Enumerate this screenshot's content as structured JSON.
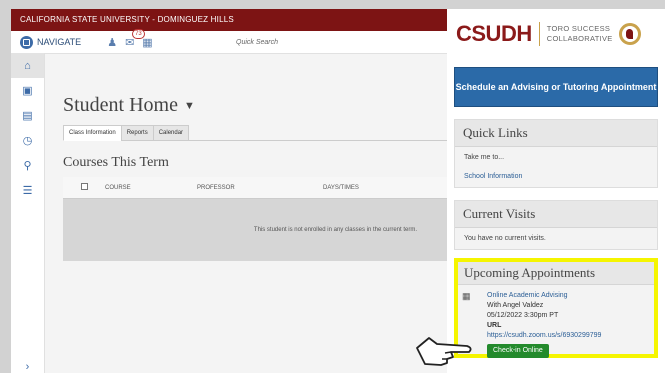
{
  "topbar": {
    "title": "CALIFORNIA STATE UNIVERSITY - DOMINGUEZ HILLS"
  },
  "nav": {
    "navigate": "NAVIGATE",
    "badge_count": "73",
    "quick_search": "Quick Search"
  },
  "main": {
    "title": "Student Home",
    "tabs": [
      {
        "label": "Class Information"
      },
      {
        "label": "Reports"
      },
      {
        "label": "Calendar"
      }
    ],
    "courses_heading": "Courses This Term",
    "table": {
      "headers": [
        "COURSE",
        "PROFESSOR",
        "DAYS/TIMES"
      ],
      "empty_message": "This student is not enrolled in any classes in the current term."
    }
  },
  "sidebar": {
    "logo": {
      "name": "CSUDH",
      "collab_line1": "TORO SUCCESS",
      "collab_line2": "COLLABORATIVE"
    },
    "schedule_button": "Schedule an Advising or Tutoring Appointment",
    "quick_links": {
      "title": "Quick Links",
      "text": "Take me to...",
      "link": "School Information"
    },
    "current_visits": {
      "title": "Current Visits",
      "text": "You have no current visits."
    },
    "upcoming": {
      "title": "Upcoming Appointments",
      "item": {
        "name": "Online Academic Advising",
        "with": "With Angel Valdez",
        "datetime": "05/12/2022 3:30pm PT",
        "url_label": "URL",
        "url": "https://csudh.zoom.us/s/6930299799",
        "checkin": "Check-in Online"
      }
    }
  }
}
